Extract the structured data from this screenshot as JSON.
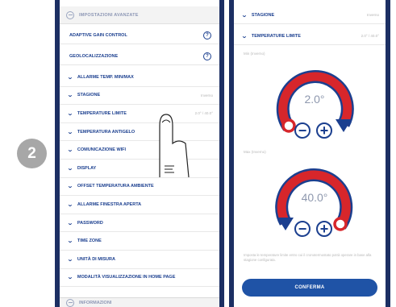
{
  "step": {
    "number": "2"
  },
  "left_phone": {
    "section_header": "IMPOSTAZIONI AVANZATE",
    "sub_items": [
      {
        "label": "ADAPTIVE GAIN CONTROL",
        "icon": "info-icon",
        "icon_glyph": "?"
      },
      {
        "label": "GEOLOCALIZZAZIONE",
        "icon": "info-icon",
        "icon_glyph": "?"
      }
    ],
    "menu_items": [
      {
        "label": "ALLARME TEMP. MIN/MAX",
        "value": ""
      },
      {
        "label": "STAGIONE",
        "value": "Inverno"
      },
      {
        "label": "TEMPERATURE LIMITE",
        "value": "2.0° / 40.0°"
      },
      {
        "label": "TEMPERATURA ANTIGELO",
        "value": ""
      },
      {
        "label": "COMUNICAZIONE WIFI",
        "value": ""
      },
      {
        "label": "DISPLAY",
        "value": ""
      },
      {
        "label": "OFFSET TEMPERATURA AMBIENTE",
        "value": ""
      },
      {
        "label": "ALLARME FINESTRA APERTA",
        "value": ""
      },
      {
        "label": "PASSWORD",
        "value": ""
      },
      {
        "label": "TIME ZONE",
        "value": ""
      },
      {
        "label": "UNITÀ DI MISURA",
        "value": ""
      },
      {
        "label": "MODALITÀ VISUALIZZAZIONE IN HOME PAGE",
        "value": ""
      }
    ],
    "bottom_section": "INFORMAZIONI"
  },
  "right_phone": {
    "rows": [
      {
        "label": "STAGIONE",
        "value": "Inverno"
      },
      {
        "label": "TEMPERATURE LIMITE",
        "value": "2.0° / 40.0°"
      }
    ],
    "min_caption": "Min (Inverno)",
    "max_caption": "Max (Inverno)",
    "min_dial": {
      "value": "2.0°",
      "minus": "−",
      "plus": "+"
    },
    "max_dial": {
      "value": "40.0°",
      "minus": "−",
      "plus": "+"
    },
    "note": "Imposta le temperature limite entro cui il cronotermostato potrà operare in base alla stagione configurata.",
    "confirm_label": "CONFERMA"
  },
  "colors": {
    "navy": "#1b3f8f",
    "frame": "#1c2f63",
    "dial_red": "#d7262b",
    "button_blue": "#1f53a6"
  }
}
